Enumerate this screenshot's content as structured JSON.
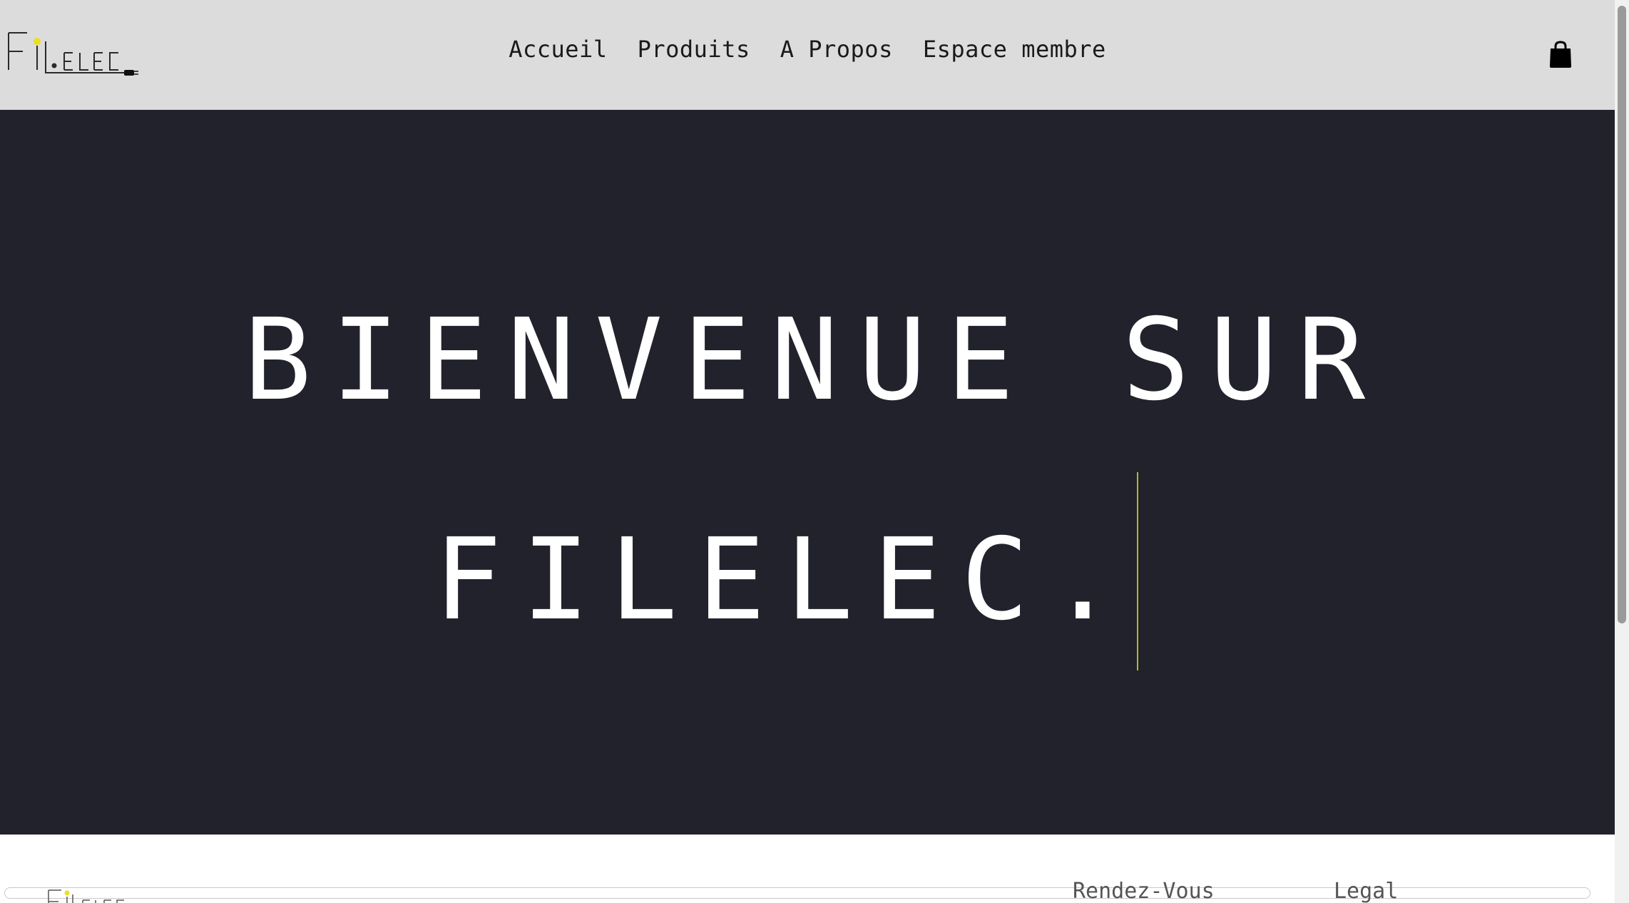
{
  "header": {
    "logo_text": "FiLELEC",
    "nav": [
      {
        "label": "Accueil"
      },
      {
        "label": "Produits"
      },
      {
        "label": "A Propos"
      },
      {
        "label": "Espace membre"
      }
    ],
    "cart_icon": "shopping-bag-icon"
  },
  "hero": {
    "line1": "BIENVENUE SUR",
    "line2": "FILELEC.",
    "background": "#21222b",
    "cursor_color": "#b9b52a"
  },
  "footer": {
    "logo_text": "FiLELEC",
    "links": [
      {
        "label": "Rendez-Vous"
      },
      {
        "label": "Legal"
      }
    ]
  },
  "colors": {
    "header_bg": "#dcdcdc",
    "logo_bulb": "#e8e020"
  }
}
